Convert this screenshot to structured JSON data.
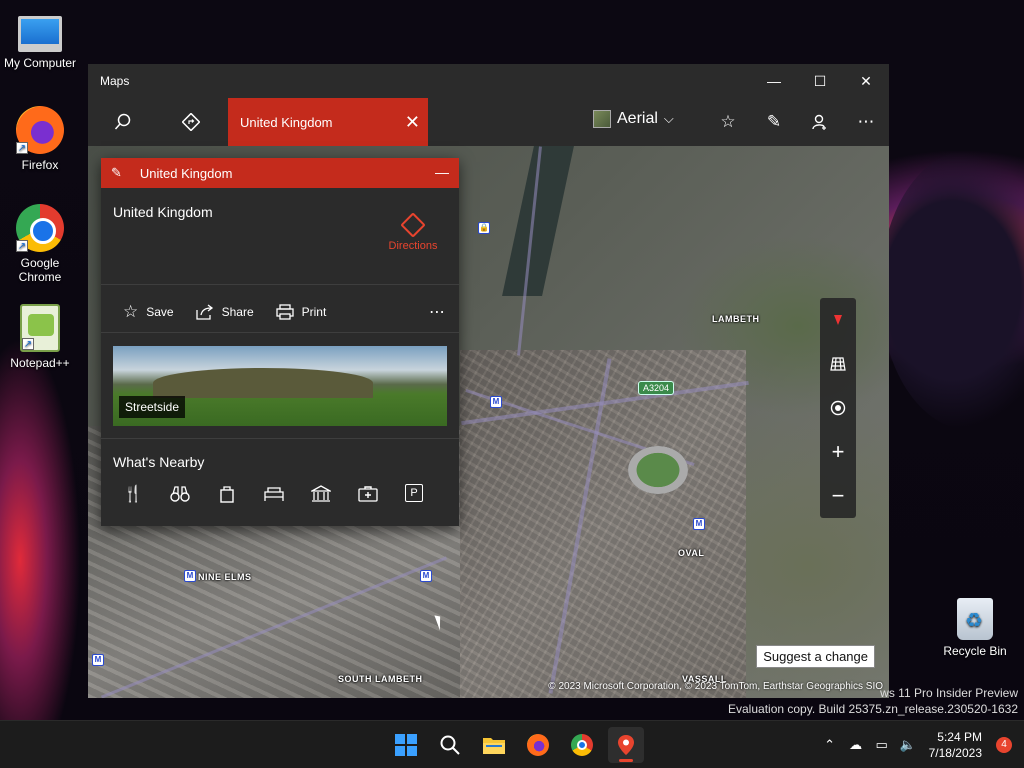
{
  "desktop": {
    "icons": [
      {
        "label": "My Computer",
        "icon": "monitor-icon"
      },
      {
        "label": "Firefox",
        "icon": "firefox-icon"
      },
      {
        "label": "Google Chrome",
        "icon": "chrome-icon"
      },
      {
        "label": "Notepad++",
        "icon": "notepad-icon"
      },
      {
        "label": "Recycle Bin",
        "icon": "recycle-bin-icon"
      }
    ],
    "watermark_line1": "ws 11 Pro Insider Preview",
    "watermark_line2": "Evaluation copy. Build 25375.zn_release.230520-1632"
  },
  "window": {
    "title": "Maps",
    "controls": {
      "minimize": "—",
      "maximize": "☐",
      "close": "✕"
    }
  },
  "toolbar": {
    "search_tab_label": "United Kingdom",
    "view_label": "Aerial"
  },
  "card": {
    "header": "United Kingdom",
    "title": "United Kingdom",
    "directions_label": "Directions",
    "actions": [
      {
        "label": "Save",
        "icon": "star-icon"
      },
      {
        "label": "Share",
        "icon": "share-icon"
      },
      {
        "label": "Print",
        "icon": "print-icon"
      }
    ],
    "streetside_label": "Streetside",
    "nearby_title": "What's Nearby",
    "nearby_icons": [
      "restaurant-icon",
      "attractions-icon",
      "shopping-icon",
      "hotel-icon",
      "museum-icon",
      "hospital-icon",
      "parking-icon"
    ]
  },
  "map": {
    "labels": {
      "lambeth": "LAMBETH",
      "oval": "OVAL",
      "nine_elms": "NINE ELMS",
      "south_lambeth": "SOUTH LAMBETH",
      "vassall": "VASSALL"
    },
    "road_badge": "A3204",
    "metro_symbol": "M",
    "suggest_label": "Suggest a change",
    "copyright": "© 2023 Microsoft Corporation, © 2023 TomTom, Earthstar Geographics  SIO"
  },
  "taskbar": {
    "time": "5:24 PM",
    "date": "7/18/2023",
    "notification_count": "4"
  }
}
